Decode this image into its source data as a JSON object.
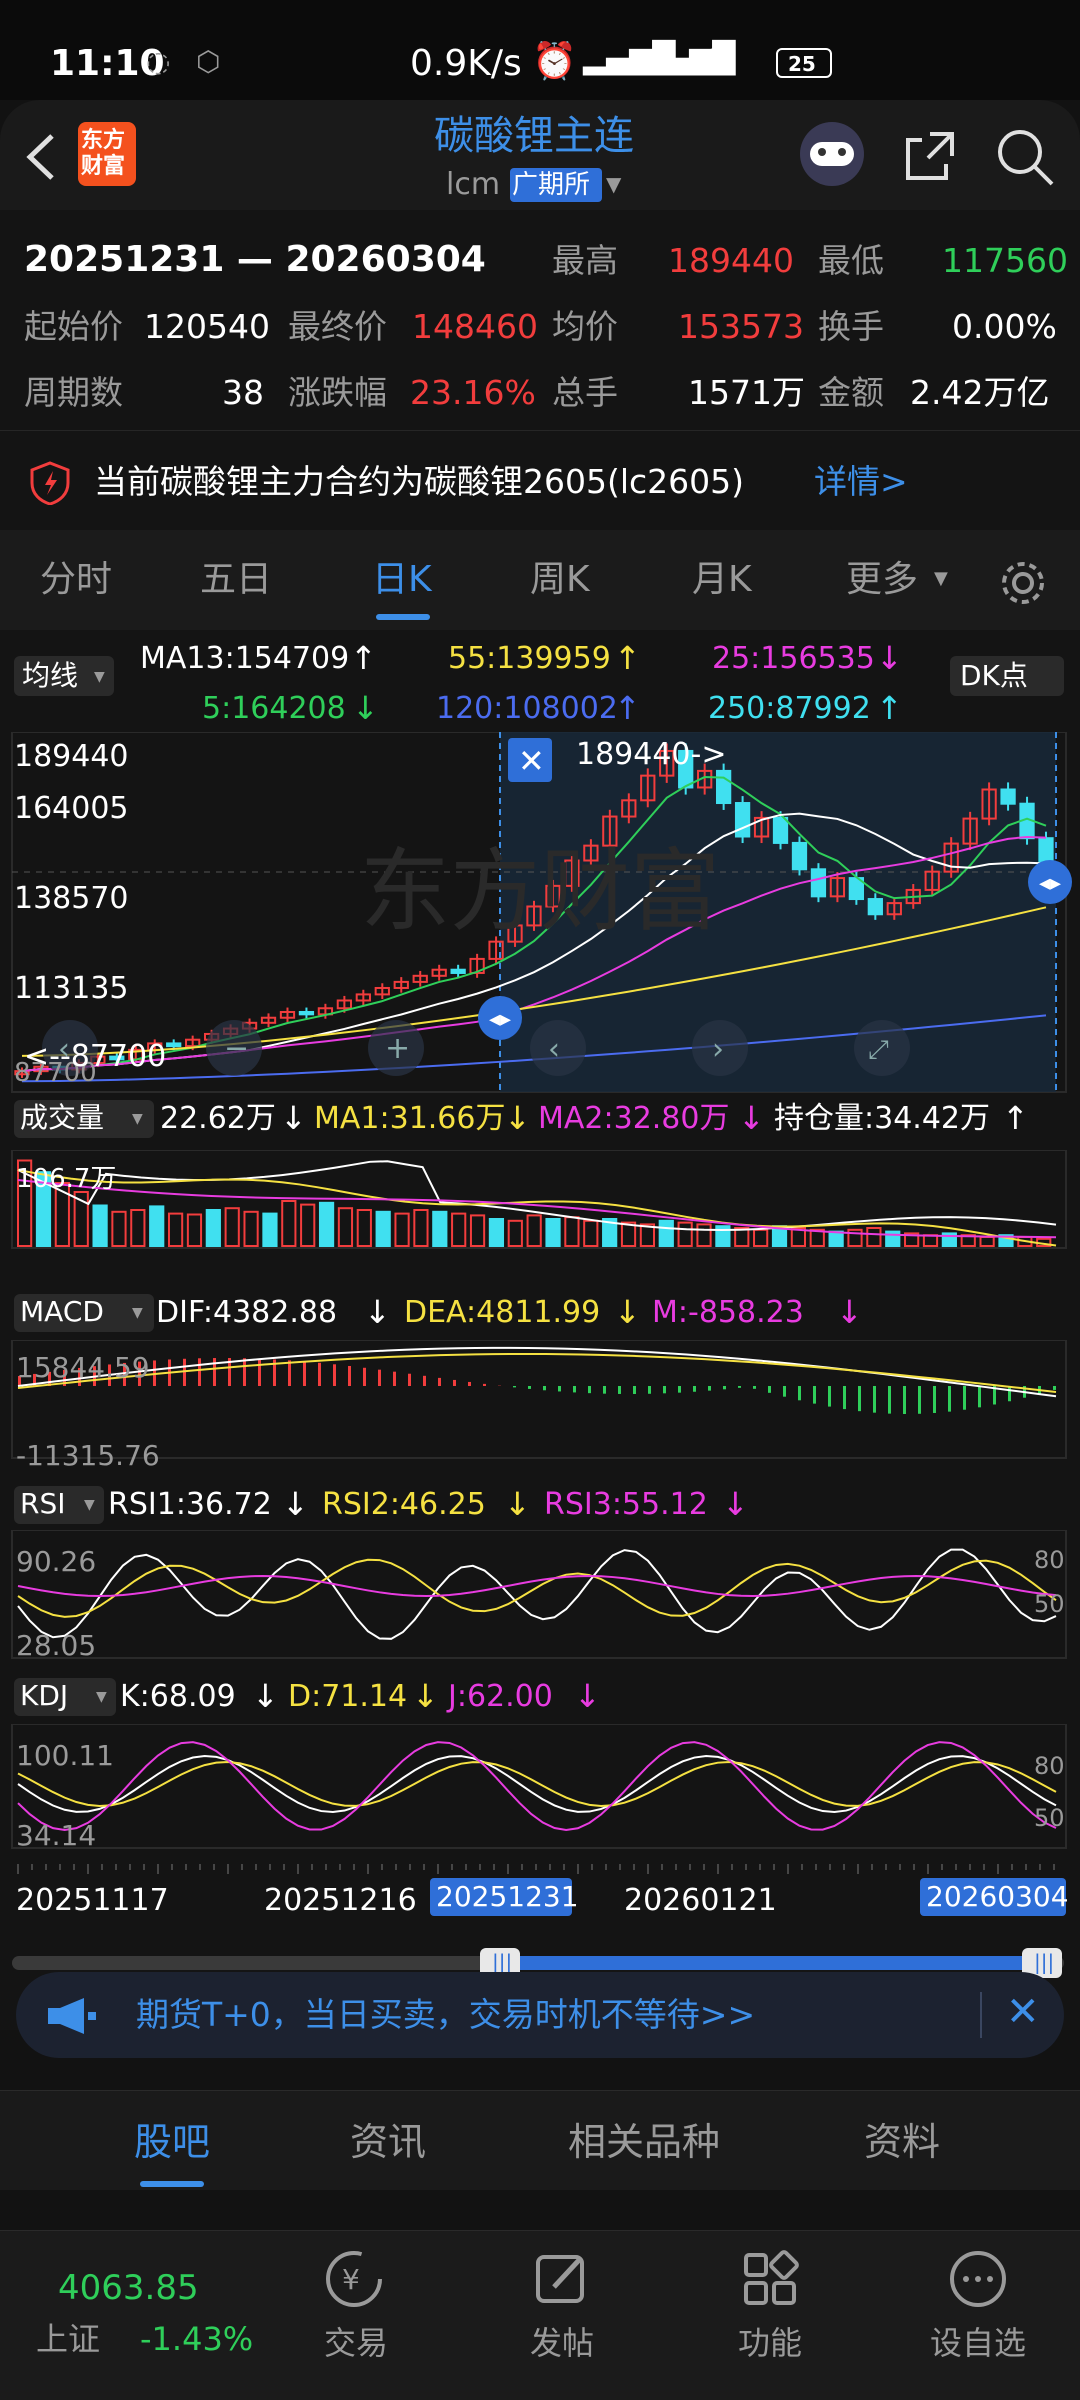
{
  "status": {
    "time": "11:10",
    "speed": "0.9K/s",
    "battery": "25"
  },
  "header": {
    "title": "碳酸锂主连",
    "code": "lcm",
    "exchange": "广期所",
    "logo_top": "东方",
    "logo_bottom": "财富"
  },
  "info": {
    "date_range": "20251231 — 20260304",
    "high_label": "最高",
    "high": "189440",
    "low_label": "最低",
    "low": "117560",
    "open_label": "起始价",
    "open": "120540",
    "close_label": "最终价",
    "close": "148460",
    "avg_label": "均价",
    "avg": "153573",
    "turnover_label": "换手",
    "turnover": "0.00%",
    "periods_label": "周期数",
    "periods": "38",
    "change_label": "涨跌幅",
    "change": "23.16%",
    "volume_label": "总手",
    "volume": "1571万",
    "amount_label": "金额",
    "amount": "2.42万亿"
  },
  "notice": {
    "text": "当前碳酸锂主力合约为碳酸锂2605(lc2605)",
    "link": "详情>"
  },
  "tabs": {
    "items": [
      "分时",
      "五日",
      "日K",
      "周K",
      "月K",
      "更多"
    ],
    "active": "日K"
  },
  "ma": {
    "button": "均线",
    "dk": "DK点",
    "ma13": "MA13:154709",
    "ma5": "5:164208",
    "ma55": "55:139959",
    "ma120": "120:108002",
    "ma25": "25:156535",
    "ma250": "250:87992"
  },
  "main_axis": {
    "y1": "189440",
    "y2": "164005",
    "y3": "138570",
    "y4": "113135",
    "y5": "87700",
    "low_label": "<--87700",
    "high_marker": "189440->"
  },
  "volume": {
    "button": "成交量",
    "v": "22.62万",
    "ma1": "MA1:31.66万",
    "ma2": "MA2:32.80万",
    "oi": "持仓量:34.42万",
    "axis": "106.7万"
  },
  "macd": {
    "button": "MACD",
    "dif": "DIF:4382.88",
    "dea": "DEA:4811.99",
    "m": "M:-858.23",
    "y_top": "15844.59",
    "y_bottom": "-11315.76"
  },
  "rsi": {
    "button": "RSI",
    "r1": "RSI1:36.72",
    "r2": "RSI2:46.25",
    "r3": "RSI3:55.12",
    "y_top": "90.26",
    "y_bottom": "28.05",
    "r80": "80",
    "r50": "50"
  },
  "kdj": {
    "button": "KDJ",
    "k": "K:68.09",
    "d": "D:71.14",
    "j": "J:62.00",
    "y_top": "100.11",
    "y_bottom": "34.14",
    "r80": "80",
    "r50": "50"
  },
  "xaxis": {
    "d1": "20251117",
    "d2": "20251216",
    "d3": "20260121",
    "sel_start": "20251231",
    "sel_end": "20260304"
  },
  "banner": {
    "text": "期货T+0，当日买卖，交易时机不等待>>"
  },
  "bottom_tabs": {
    "items": [
      "股吧",
      "资讯",
      "相关品种",
      "资料"
    ],
    "active": "股吧"
  },
  "footer": {
    "index_value": "4063.85",
    "index_name": "上证",
    "index_change": "-1.43%",
    "items": [
      "交易",
      "发帖",
      "功能",
      "设自选"
    ]
  },
  "chart_data": {
    "type": "candlestick",
    "title": "碳酸锂主连 日K",
    "ylim": [
      87700,
      189440
    ],
    "closes": [
      91500,
      92800,
      92000,
      93900,
      95800,
      95000,
      97800,
      99700,
      98900,
      100800,
      102500,
      104100,
      105800,
      107300,
      109000,
      108300,
      110100,
      112400,
      114200,
      116100,
      117900,
      119700,
      121500,
      120540,
      124700,
      129800,
      134600,
      140200,
      146300,
      153800,
      158200,
      166800,
      171600,
      178900,
      186200,
      175400,
      180300,
      170800,
      160900,
      166400,
      159000,
      151200,
      143200,
      148600,
      142400,
      137900,
      141200,
      145100,
      150500,
      158800,
      166200,
      174800,
      170600,
      160400,
      148460
    ],
    "ma": {
      "MA5": 164208,
      "MA13": 154709,
      "MA25": 156535,
      "MA55": 139959,
      "MA120": 108002,
      "MA250": 87992
    }
  }
}
